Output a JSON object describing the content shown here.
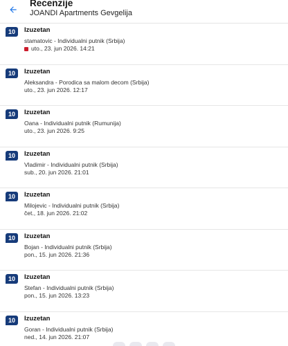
{
  "header": {
    "title": "Recenzije",
    "subtitle": "JOANDI Apartments Gevgelija",
    "back_icon": "arrow-left-icon",
    "accent_color": "#1a73e8"
  },
  "badge_color": "#163b7a",
  "flag_color": "#cc1c2c",
  "reviews": [
    {
      "score": "10",
      "title": "Izuzetan",
      "reviewer": "stamatovic - Individualni putnik (Srbija)",
      "date": "uto., 23. jun 2026. 14:21",
      "flagged": true
    },
    {
      "score": "10",
      "title": "Izuzetan",
      "reviewer": "Aleksandra - Porodica sa malom decom (Srbija)",
      "date": "uto., 23. jun 2026. 12:17",
      "flagged": false
    },
    {
      "score": "10",
      "title": "Izuzetan",
      "reviewer": "Oana - Individualni putnik (Rumunija)",
      "date": "uto., 23. jun 2026. 9:25",
      "flagged": false
    },
    {
      "score": "10",
      "title": "Izuzetan",
      "reviewer": "Vladimir - Individualni putnik (Srbija)",
      "date": "sub., 20. jun 2026. 21:01",
      "flagged": false
    },
    {
      "score": "10",
      "title": "Izuzetan",
      "reviewer": "Milojevic - Individualni putnik (Srbija)",
      "date": "čet., 18. jun 2026. 21:02",
      "flagged": false
    },
    {
      "score": "10",
      "title": "Izuzetan",
      "reviewer": "Bojan - Individualni putnik (Srbija)",
      "date": "pon., 15. jun 2026. 21:36",
      "flagged": false
    },
    {
      "score": "10",
      "title": "Izuzetan",
      "reviewer": "Stefan - Individualni putnik (Srbija)",
      "date": "pon., 15. jun 2026. 13:23",
      "flagged": false
    },
    {
      "score": "10",
      "title": "Izuzetan",
      "reviewer": "Goran - Individualni putnik (Srbija)",
      "date": "ned., 14. jun 2026. 21:07",
      "flagged": false
    }
  ]
}
